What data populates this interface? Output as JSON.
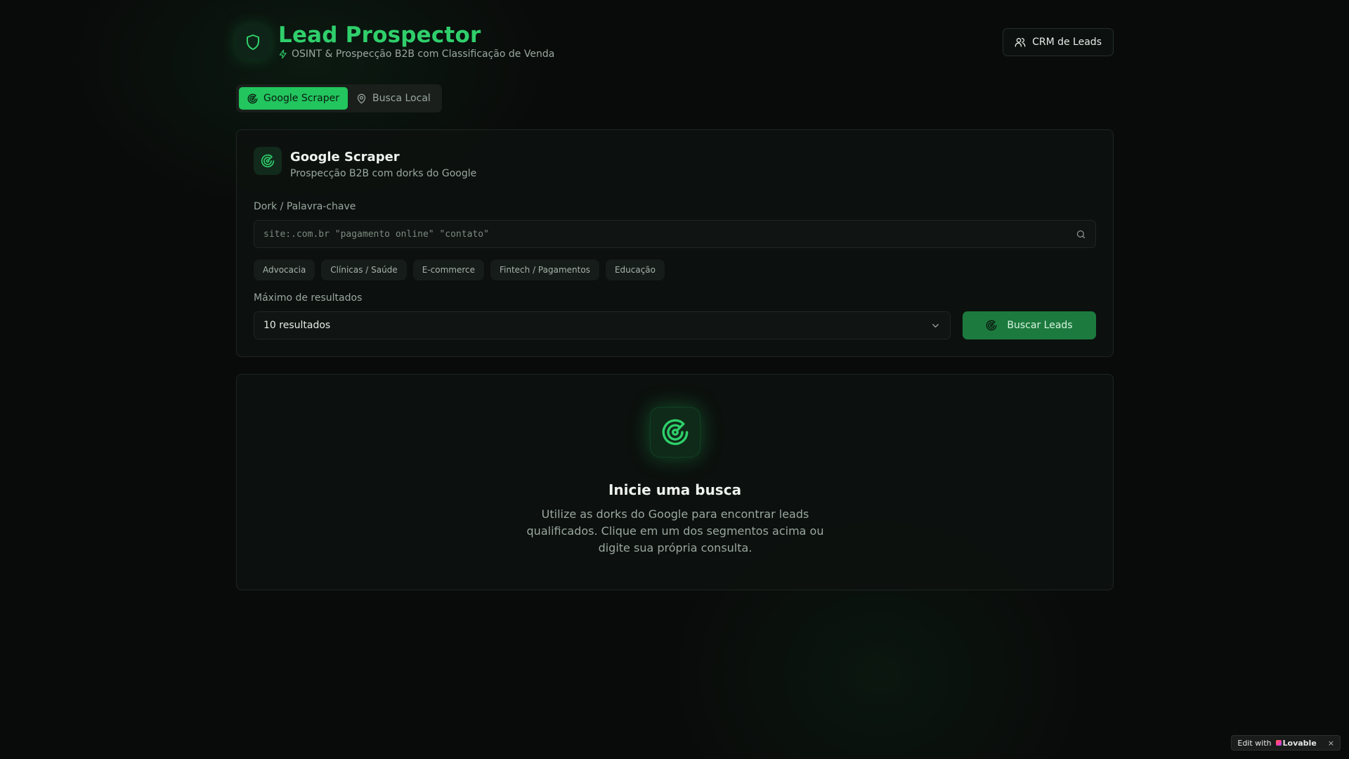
{
  "colors": {
    "accent": "#22c55e",
    "accent_title": "#2fcf6b",
    "button": "#1c7a3e",
    "background": "#090b0a"
  },
  "header": {
    "title": "Lead Prospector",
    "subtitle": "OSINT & Prospecção B2B com Classificação de Venda",
    "brand_icon": "shield-icon",
    "subtitle_icon": "lightning-icon",
    "crm_button": {
      "label": "CRM de Leads",
      "icon": "users-icon"
    }
  },
  "tabs": [
    {
      "label": "Google Scraper",
      "icon": "radar-icon",
      "active": true
    },
    {
      "label": "Busca Local",
      "icon": "map-pin-icon",
      "active": false
    }
  ],
  "search_card": {
    "title": "Google Scraper",
    "subtitle": "Prospecção B2B com dorks do Google",
    "dork_label": "Dork / Palavra-chave",
    "dork_placeholder": "site:.com.br \"pagamento online\" \"contato\"",
    "dork_value": "",
    "segments": [
      "Advocacia",
      "Clínicas / Saúde",
      "E-commerce",
      "Fintech / Pagamentos",
      "Educação"
    ],
    "max_label": "Máximo de resultados",
    "max_selected": "10 resultados",
    "submit_label": "Buscar Leads"
  },
  "empty_state": {
    "title": "Inicie uma busca",
    "text": "Utilize as dorks do Google para encontrar leads qualificados. Clique em um dos segmentos acima ou digite sua própria consulta."
  },
  "badge": {
    "prefix": "Edit with",
    "brand": "Lovable",
    "close": "×"
  }
}
